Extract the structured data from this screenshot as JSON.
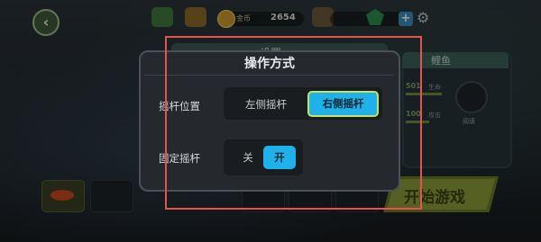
{
  "top_bar": {
    "back_icon_glyph": "‹",
    "coin_label": "金币",
    "coin_value": "2654",
    "plus_glyph": "+",
    "gear_glyph": "⚙"
  },
  "background": {
    "settings_tab_text": "设置",
    "right_panel_title": "鲤鱼",
    "stat_1_value": "501",
    "stat_1_label": "生命",
    "stat_2_value": "100",
    "stat_2_label": "攻击",
    "avatar_label": "阅读",
    "start_button_label": "开始游戏"
  },
  "dialog": {
    "title": "操作方式",
    "joystick_position": {
      "label": "摇杆位置",
      "options": [
        "左侧摇杆",
        "右侧摇杆"
      ],
      "selected": "右侧摇杆"
    },
    "fixed_joystick": {
      "label": "固定摇杆",
      "options": [
        "关",
        "开"
      ],
      "selected": "开"
    }
  },
  "colors": {
    "accent": "#1fb1ea",
    "highlight_border": "#c7e25c",
    "annotation_frame": "#e25450"
  }
}
